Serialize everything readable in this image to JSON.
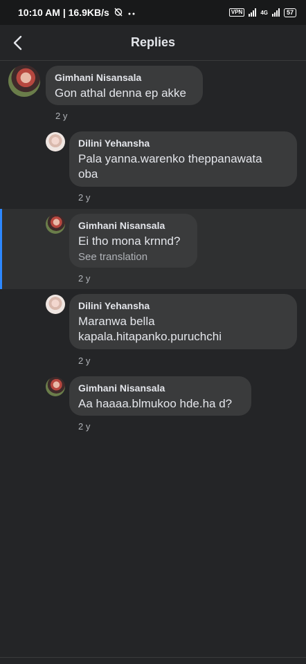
{
  "status_bar": {
    "time": "10:10 AM | 16.9KB/s",
    "vpn": "VPN",
    "network": "4G",
    "battery": "57",
    "icons": [
      "alarm-off-icon",
      "more-dots-icon",
      "signal-icon",
      "battery-icon"
    ]
  },
  "header": {
    "title": "Replies",
    "back_icon": "chevron-left-icon"
  },
  "replies": [
    {
      "author": "Gimhani Nisansala",
      "text": "Gon athal denna ep akke",
      "time": "2 y"
    },
    {
      "author": "Dilini Yehansha",
      "text_lines": [
        "Pala yanna.warenko theppanawata",
        "oba"
      ],
      "time": "2 y"
    },
    {
      "author": "Gimhani Nisansala",
      "text": "Ei tho mona krnnd?",
      "translation": "See translation",
      "time": "2 y"
    },
    {
      "author": "Dilini Yehansha",
      "text_lines": [
        "Maranwa bella",
        "kapala.hitapanko.puruchchi"
      ],
      "time": "2 y"
    },
    {
      "author": "Gimhani Nisansala",
      "text": "Aa haaaa.blmukoo hde.ha d?",
      "time": "2 y"
    }
  ],
  "colors": {
    "background": "#242527",
    "bubble": "#3a3b3c",
    "highlight": "#2f3031",
    "accent": "#2d88ff",
    "muted_text": "#b0b3b8"
  }
}
